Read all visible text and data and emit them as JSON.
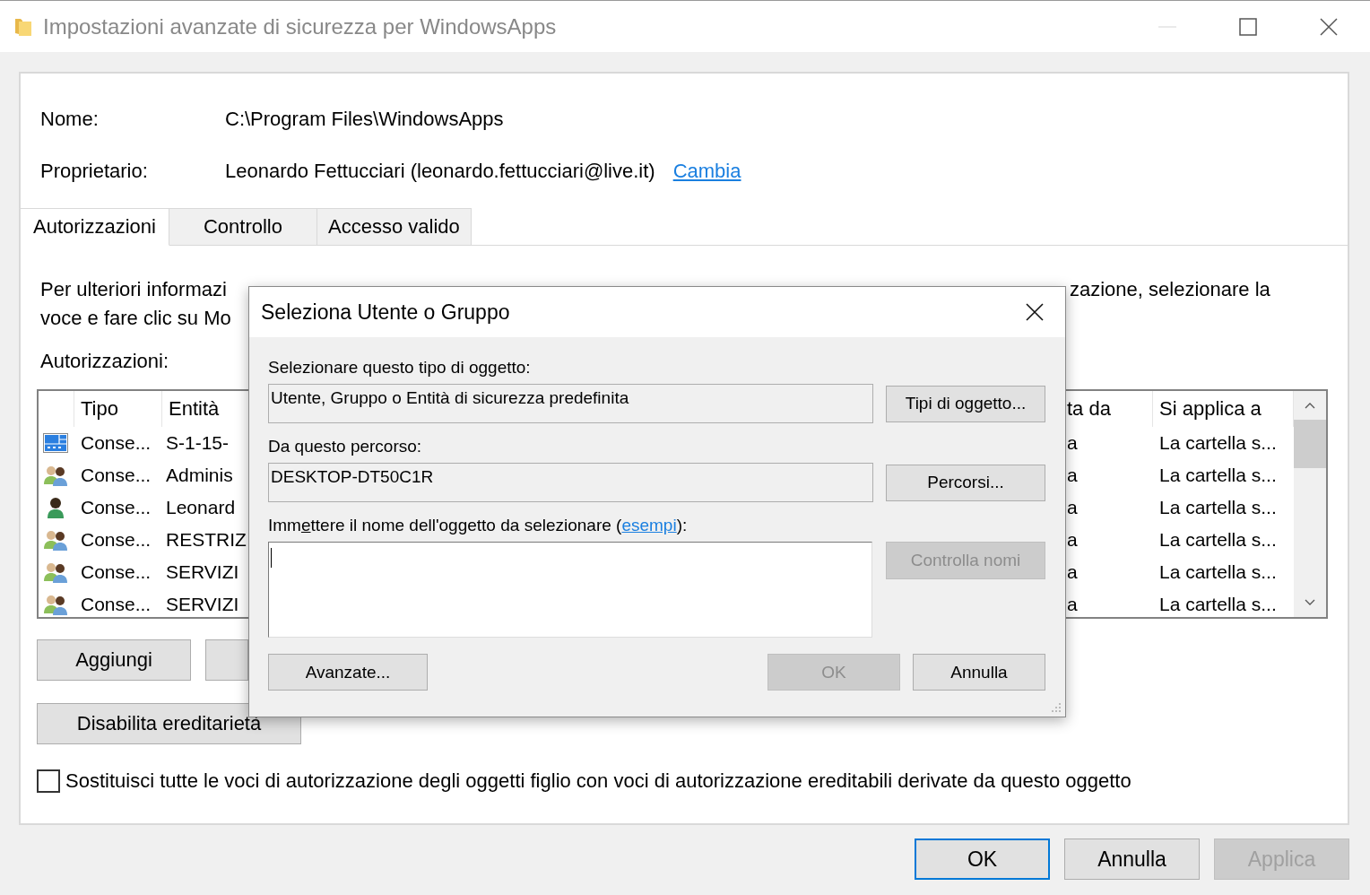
{
  "window": {
    "title": "Impostazioni avanzate di sicurezza per WindowsApps"
  },
  "details": [
    {
      "label": "Nome:",
      "value": "C:\\Program Files\\WindowsApps"
    },
    {
      "label": "Proprietario:",
      "value": "Leonardo Fettucciari (leonardo.fettucciari@live.it)",
      "link": "Cambia"
    }
  ],
  "tabs": [
    {
      "label": "Autorizzazioni",
      "selected": true
    },
    {
      "label": "Controllo",
      "selected": false
    },
    {
      "label": "Accesso valido",
      "selected": false
    }
  ],
  "info": {
    "line_1_left": "Per ulteriori informazi",
    "line_1_right": "zazione, selezionare la",
    "line_2_left": "voce e fare clic su Mo"
  },
  "permissions_label": "Autorizzazioni:",
  "table": {
    "columns": [
      "Tipo",
      "Entità",
      "ta da",
      "Si applica a"
    ],
    "rows": [
      {
        "kind": "app",
        "cells": [
          "Conse...",
          "S-1-15-",
          "a",
          "La cartella s..."
        ]
      },
      {
        "kind": "group",
        "cells": [
          "Conse...",
          "Adminis",
          "a",
          "La cartella s..."
        ]
      },
      {
        "kind": "user",
        "cells": [
          "Conse...",
          "Leonard",
          "a",
          "La cartella s..."
        ]
      },
      {
        "kind": "group",
        "cells": [
          "Conse...",
          "RESTRIZ",
          "a",
          "La cartella s..."
        ]
      },
      {
        "kind": "group",
        "cells": [
          "Conse...",
          "SERVIZI",
          "a",
          "La cartella s..."
        ]
      },
      {
        "kind": "group",
        "cells": [
          "Conse...",
          "SERVIZI",
          "a",
          "La cartella s..."
        ]
      }
    ]
  },
  "add_button": "Aggiungi",
  "disable_inheritance_button": "Disabilita ereditarietà",
  "replace_checkbox": {
    "label": "Sostituisci tutte le voci di autorizzazione degli oggetti figlio con voci di autorizzazione ereditabili derivate da questo oggetto",
    "checked": false
  },
  "footer_buttons": [
    {
      "label": "OK",
      "default": true,
      "disabled": false
    },
    {
      "label": "Annulla",
      "default": false,
      "disabled": false
    },
    {
      "label": "Applica",
      "default": false,
      "disabled": true
    }
  ],
  "dialog": {
    "title": "Seleziona Utente o Gruppo",
    "object_type_label": "Selezionare questo tipo di oggetto:",
    "object_type_value": "Utente, Gruppo o Entità di sicurezza predefinita",
    "object_types_button": "Tipi di oggetto...",
    "location_label": "Da questo percorso:",
    "location_value": "DESKTOP-DT50C1R",
    "locations_button": "Percorsi...",
    "name_label": {
      "before": "Imm",
      "access_key": "e",
      "after": "ttere il nome dell'oggetto da selezionare (",
      "link": "esempi",
      "end": "):"
    },
    "check_names_button": {
      "label": "Controlla nomi",
      "disabled": true
    },
    "advanced_button": "Avanzate...",
    "buttons": [
      {
        "label": "OK",
        "disabled": true
      },
      {
        "label": "Annulla",
        "disabled": false
      }
    ]
  }
}
